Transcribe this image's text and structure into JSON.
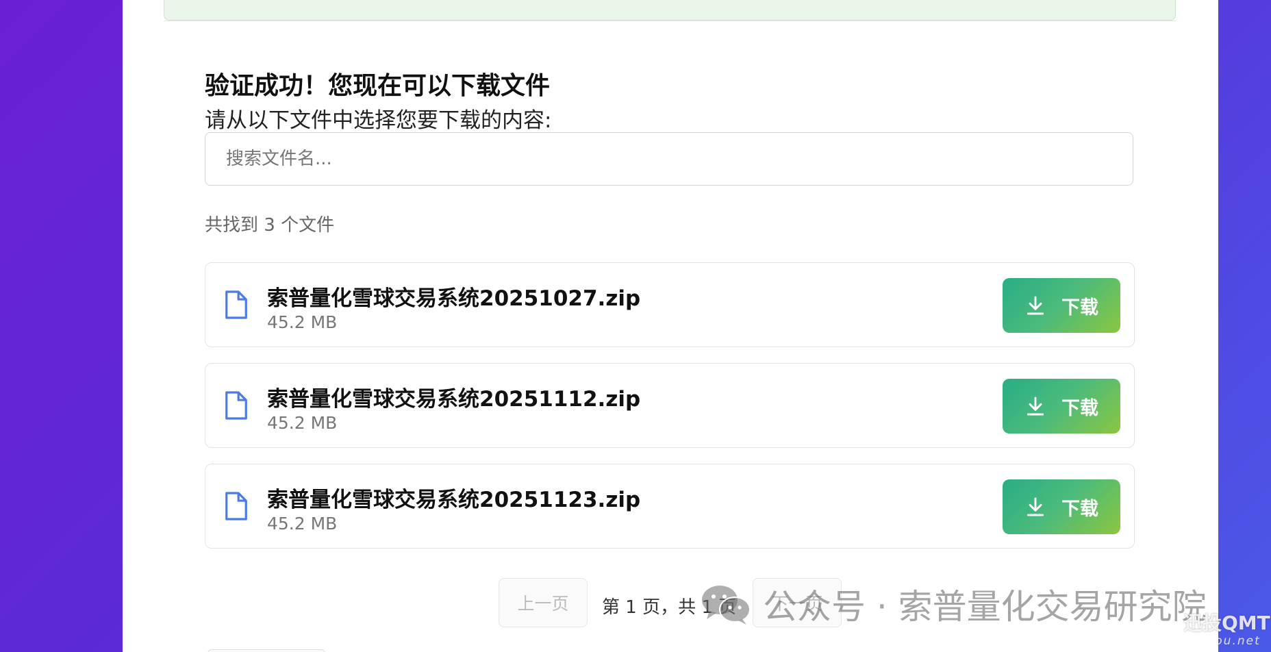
{
  "content": {
    "heading": "验证成功！您现在可以下载文件",
    "subheading": "请从以下文件中选择您要下载的内容:",
    "search": {
      "placeholder": "搜索文件名...",
      "value": ""
    },
    "result_count": "共找到 3 个文件",
    "files": [
      {
        "name": "索普量化雪球交易系统20251027.zip",
        "size": "45.2 MB",
        "download_label": "下载"
      },
      {
        "name": "索普量化雪球交易系统20251112.zip",
        "size": "45.2 MB",
        "download_label": "下载"
      },
      {
        "name": "索普量化雪球交易系统20251123.zip",
        "size": "45.2 MB",
        "download_label": "下载"
      }
    ],
    "pagination": {
      "prev_label": "上一页",
      "info": "第 1 页，共 1 页",
      "next_label": "下一页"
    }
  },
  "watermark": {
    "text": "公众号 · 索普量化交易研究院",
    "icon": "wechat-icon",
    "corner_brand": "迅投QMT",
    "corner_url": "xuntou.net"
  },
  "icons": {
    "file": "file-icon",
    "download": "download-icon"
  },
  "colors": {
    "background_start": "#6a1fd6",
    "background_end": "#4a5ae8",
    "accent_file_icon": "#4a7be8",
    "button_gradient_start": "#27ae86",
    "button_gradient_end": "#8cc63f",
    "success_banner": "#e9f5e9"
  }
}
